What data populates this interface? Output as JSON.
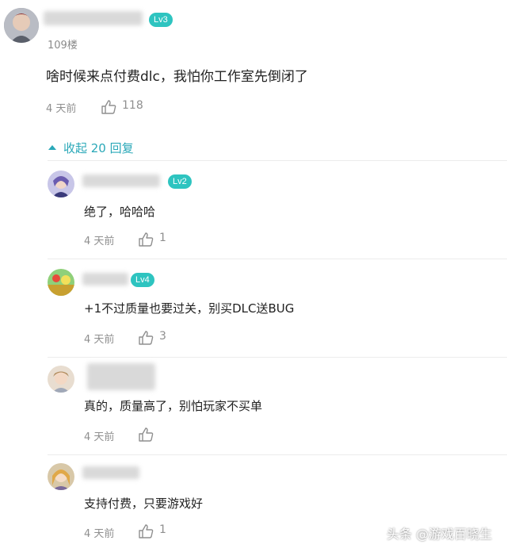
{
  "main": {
    "level": "Lv3",
    "floor": "109楼",
    "text": "啥时候来点付费dlc，我怕你工作室先倒闭了",
    "time": "4 天前",
    "likes": "118"
  },
  "collapse_label": "收起 20 回复",
  "replies": [
    {
      "level": "Lv2",
      "text": "绝了，哈哈哈",
      "time": "4 天前",
      "likes": "1"
    },
    {
      "level": "Lv4",
      "text": "+1不过质量也要过关，别买DLC送BUG",
      "time": "4 天前",
      "likes": "3"
    },
    {
      "level": "",
      "text": "真的，质量高了，别怕玩家不买单",
      "time": "4 天前",
      "likes": ""
    },
    {
      "level": "",
      "text": "支持付费，只要游戏好",
      "time": "4 天前",
      "likes": "1"
    }
  ],
  "watermark": "头条 @游戏百晓生",
  "colors": {
    "accent": "#2ec4c0",
    "link": "#2aa8b8"
  },
  "icons": [
    "thumb-up-icon",
    "caret-up-icon"
  ]
}
